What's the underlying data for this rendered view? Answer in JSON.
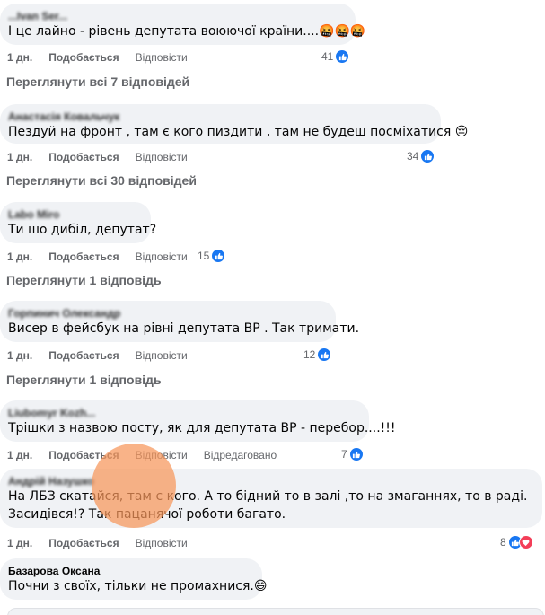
{
  "comments": [
    {
      "author": "...Ivan Ser...",
      "text": "І це лайно - рівень депутата воюючої країни....🤬🤬🤬",
      "time": "1 дн.",
      "like": "Подобається",
      "reply": "Відповісти",
      "reactions": "41",
      "view_replies": "Переглянути всі 7 відповідей"
    },
    {
      "author": "Анастасія Ковальчук",
      "text": "Пездуй на фронт , там є кого пиздити , там не будеш посміхатися 😔",
      "time": "1 дн.",
      "like": "Подобається",
      "reply": "Відповісти",
      "reactions": "34",
      "view_replies": "Переглянути всі 30 відповідей"
    },
    {
      "author": "Labo Miro",
      "text": "Ти шо дибіл, депутат?",
      "time": "1 дн.",
      "like": "Подобається",
      "reply": "Відповісти",
      "reactions": "15",
      "view_replies": "Переглянути 1 відповідь"
    },
    {
      "author": "Горпинич Олександр",
      "text": "Висер в фейсбук на рівні депутата ВР . Так тримати.",
      "time": "1 дн.",
      "like": "Подобається",
      "reply": "Відповісти",
      "reactions": "12",
      "view_replies": "Переглянути 1 відповідь"
    },
    {
      "author": "Liubomyr Kozh...",
      "text": "Трішки з назвою посту, як для депутата ВР - перебор....!!!",
      "time": "1 дн.",
      "like": "Подобається",
      "reply": "Відповісти",
      "edited": "Відредаговано",
      "reactions": "7"
    },
    {
      "author": "Андрій Назушко",
      "text_line1": "На ЛБЗ скатайся, там є кого. А то бідний то в залі ,то на змаганнях, то в раді.",
      "text_line2": "Засидівся!? Так пацанячої роботи багато.",
      "time": "1 дн.",
      "like": "Подобається",
      "reply": "Відповісти",
      "reactions": "8"
    },
    {
      "author": "Базарова Оксана",
      "text": "Почни з своїх, тільки не промахнися.😄"
    }
  ],
  "colors": {
    "bubble": "#f0f2f5",
    "secondary_text": "#65676b",
    "like_blue": "#1877f2",
    "heart_red": "#f33e58"
  },
  "icons": [
    "like-icon",
    "heart-icon"
  ]
}
